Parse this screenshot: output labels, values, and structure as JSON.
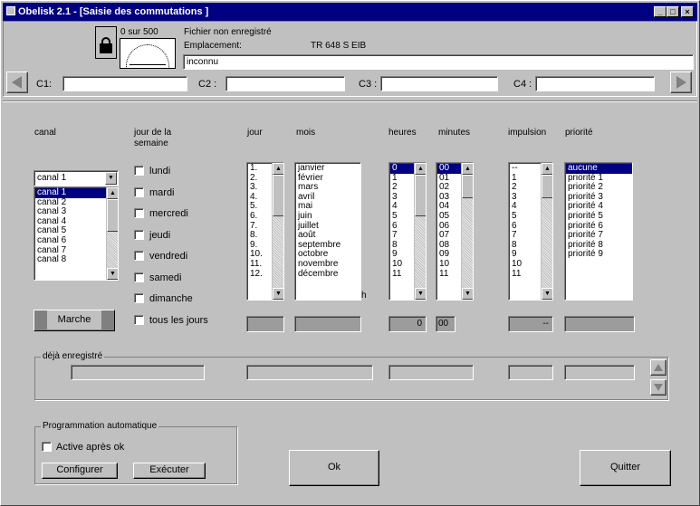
{
  "window": {
    "title": "Obelisk 2.1 - [Saisie des commutations ]"
  },
  "header": {
    "counter": "0 sur 500",
    "file_status": "Fichier non enregistré",
    "location_label": "Emplacement:",
    "device": "TR 648 S EIB",
    "name_value": "inconnu",
    "channels": [
      {
        "label": "C1:",
        "value": ""
      },
      {
        "label": "C2 :",
        "value": ""
      },
      {
        "label": "C3 :",
        "value": ""
      },
      {
        "label": "C4 :",
        "value": ""
      }
    ]
  },
  "columns": {
    "canal": "canal",
    "jour_semaine": "jour de la semaine",
    "jour": "jour",
    "mois": "mois",
    "heures": "heures",
    "minutes": "minutes",
    "impulsion": "impulsion",
    "priorite": "priorité"
  },
  "canal": {
    "selected": "canal 1",
    "options": [
      "canal 1",
      "canal 2",
      "canal 3",
      "canal 4",
      "canal 5",
      "canal 6",
      "canal 7",
      "canal 8"
    ],
    "marche": "Marche"
  },
  "weekdays": [
    "lundi",
    "mardi",
    "mercredi",
    "jeudi",
    "vendredi",
    "samedi",
    "dimanche",
    "tous les jours"
  ],
  "jour_list": [
    "1.",
    "2.",
    "3.",
    "4.",
    "5.",
    "6.",
    "7.",
    "8.",
    "9.",
    "10.",
    "11.",
    "12."
  ],
  "mois_list": [
    "janvier",
    "février",
    "mars",
    "avril",
    "mai",
    "juin",
    "juillet",
    "août",
    "septembre",
    "octobre",
    "novembre",
    "décembre"
  ],
  "mois_suffix": "h",
  "heures_list": [
    "0",
    "1",
    "2",
    "3",
    "4",
    "5",
    "6",
    "7",
    "8",
    "9",
    "10",
    "11"
  ],
  "minutes_list": [
    "00",
    "01",
    "02",
    "03",
    "04",
    "05",
    "06",
    "07",
    "08",
    "09",
    "10",
    "11"
  ],
  "impulsion_list": [
    "--",
    "1",
    "2",
    "3",
    "4",
    "5",
    "6",
    "7",
    "8",
    "9",
    "10",
    "11"
  ],
  "priorite_list": [
    "aucune",
    "priorité 1",
    "priorité 2",
    "priorité 3",
    "priorité 4",
    "priorité 5",
    "priorité 6",
    "priorité 7",
    "priorité 8",
    "priorité 9"
  ],
  "summary": {
    "heures": "0",
    "minutes": "00",
    "impulsion": "--"
  },
  "deja": {
    "title": "déjà enregistré"
  },
  "auto": {
    "title": "Programmation automatique",
    "active": "Active après ok",
    "configurer": "Configurer",
    "executer": "Exécuter"
  },
  "buttons": {
    "ok": "Ok",
    "quitter": "Quitter"
  }
}
